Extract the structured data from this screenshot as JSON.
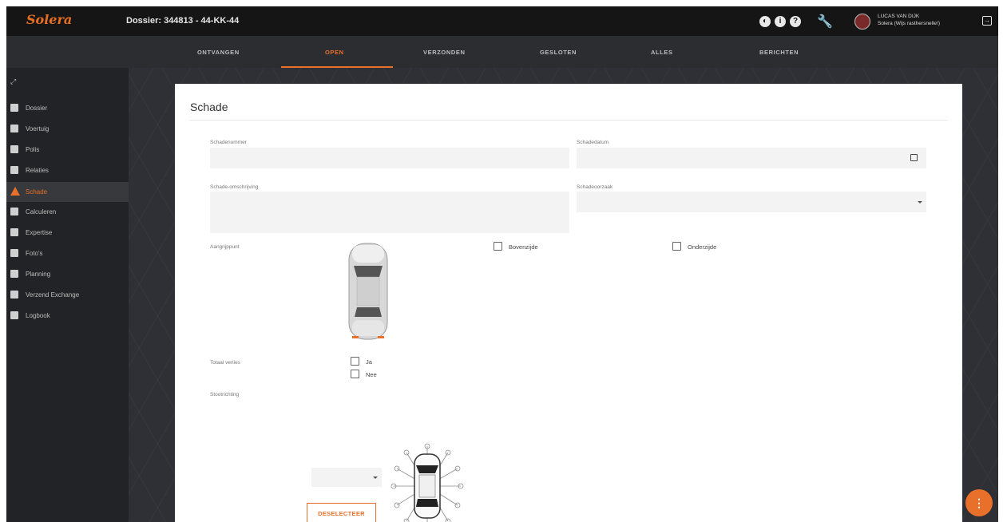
{
  "app": {
    "logo": "Solera",
    "dossier_label": "Dossier: 344813 - 44-KK-44",
    "user_name": "LUCAS VAN DIJK",
    "user_org": "Solera (Wijs rasthersnelle!)"
  },
  "tabs": [
    {
      "label": "ONTVANGEN"
    },
    {
      "label": "OPEN"
    },
    {
      "label": "VERZONDEN"
    },
    {
      "label": "GESLOTEN"
    },
    {
      "label": "ALLES"
    },
    {
      "label": "BERICHTEN"
    }
  ],
  "sidebar": {
    "items": [
      {
        "label": "Dossier"
      },
      {
        "label": "Voertuig"
      },
      {
        "label": "Polis"
      },
      {
        "label": "Relaties"
      },
      {
        "label": "Schade"
      },
      {
        "label": "Calculeren"
      },
      {
        "label": "Expertise"
      },
      {
        "label": "Foto's"
      },
      {
        "label": "Planning"
      },
      {
        "label": "Verzend Exchange"
      },
      {
        "label": "Logbook"
      }
    ]
  },
  "form": {
    "title": "Schade",
    "schadenummer_label": "Schadenummer",
    "schadedatum_label": "Schadedatum",
    "omschrijving_label": "Schade-omschrijving",
    "oorzaak_label": "Schadeoorzaak",
    "aangrijppunt_label": "Aangrijppunt",
    "bovenzijde_label": "Bovenzijde",
    "onderzijde_label": "Onderzijde",
    "totaal_verlies_label": "Totaal verlies",
    "ja_label": "Ja",
    "nee_label": "Nee",
    "stootrichting_label": "Stootrichting",
    "deselect_label": "DESELECTEER"
  },
  "colors": {
    "accent": "#e8702a",
    "topbar": "#151516",
    "sidebar": "#222326"
  }
}
